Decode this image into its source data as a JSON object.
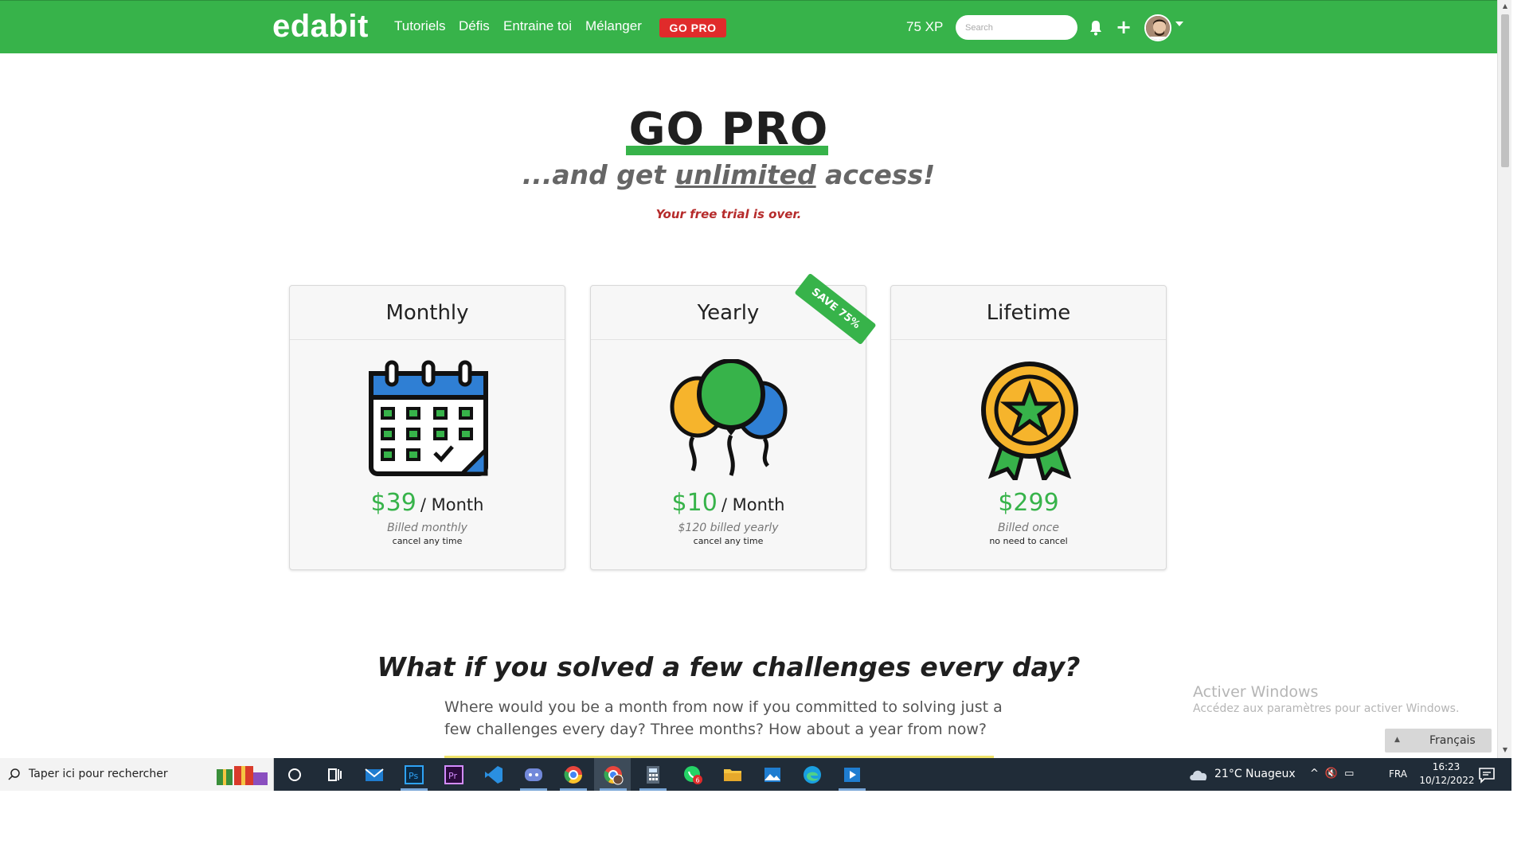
{
  "colors": {
    "brand_green": "#37b34a",
    "badge_red": "#e02b2b",
    "trial_red": "#b62b2b",
    "taskbar": "#202c38"
  },
  "navbar": {
    "logo": "edabit",
    "links": [
      "Tutoriels",
      "Défis",
      "Entraine toi",
      "Mélanger"
    ],
    "gopro_badge": "GO PRO",
    "xp": "75 XP",
    "search_placeholder": "Search",
    "icons": [
      "bell-icon",
      "plus-icon",
      "avatar"
    ]
  },
  "hero": {
    "title": "GO PRO",
    "subtitle_before": "...and get ",
    "subtitle_emph": "unlimited",
    "subtitle_after": " access!",
    "trial_notice": "Your free trial is over."
  },
  "plans": [
    {
      "name": "Monthly",
      "icon": "calendar-icon",
      "price": "$39",
      "period": "/ Month",
      "billed": "Billed monthly",
      "note": "cancel any time"
    },
    {
      "name": "Yearly",
      "icon": "balloons-icon",
      "price": "$10",
      "period": "/ Month",
      "billed": "$120 billed yearly",
      "note": "cancel any time",
      "ribbon": "SAVE 75%"
    },
    {
      "name": "Lifetime",
      "icon": "award-badge-icon",
      "price": "$299",
      "period": "",
      "billed": "Billed once",
      "note": "no need to cancel"
    }
  ],
  "section": {
    "question": "What if you solved a few challenges every day?",
    "paragraph": "Where would you be a month from now if you committed to solving just a few challenges every day? Three months? How about a year from now?"
  },
  "watermark": {
    "title": "Activer Windows",
    "subtitle": "Accédez aux paramètres pour activer Windows."
  },
  "language_widget": {
    "label": "Français"
  },
  "taskbar": {
    "search_text": "Taper ici pour rechercher",
    "weather": "21°C  Nuageux",
    "input_lang": "FRA",
    "time": "16:23",
    "date": "10/12/2022",
    "apps": [
      "cortana-icon",
      "task-view-icon",
      "mail-icon",
      "photoshop-icon",
      "premiere-icon",
      "vscode-icon",
      "discord-icon",
      "chrome-icon",
      "chrome-profile-icon",
      "calculator-icon",
      "whatsapp-icon",
      "file-explorer-icon",
      "photos-icon",
      "edge-icon",
      "media-player-icon"
    ],
    "whatsapp_badge": "6"
  }
}
